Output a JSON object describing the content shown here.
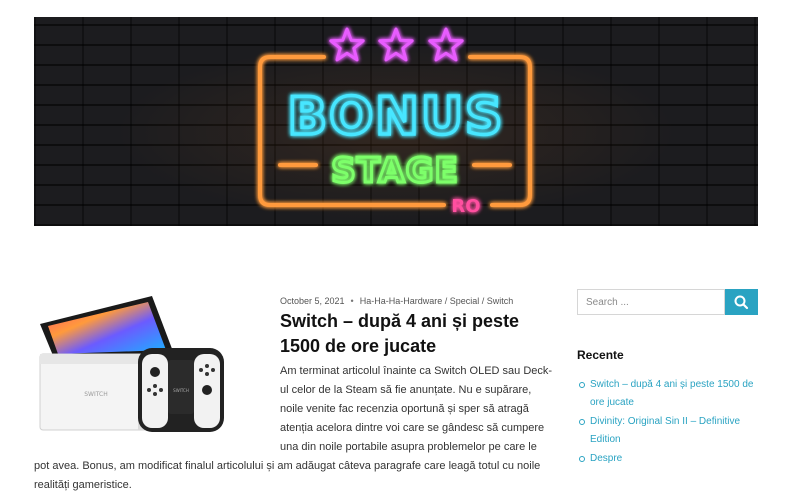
{
  "banner": {
    "word_top": "BONUS",
    "word_bottom": "STAGE",
    "suffix": "RO",
    "colors": {
      "frame": "#ff9a3c",
      "stars": "#e85cff",
      "bonus": "#47e6ff",
      "stage": "#7dff6b",
      "suffix": "#ff4fa0"
    }
  },
  "post": {
    "date": "October 5, 2021",
    "meta_separator": "•",
    "categories": [
      "Ha-Ha-Ha-Hardware",
      "Special",
      "Switch"
    ],
    "category_separator": " / ",
    "title": "Switch – după 4 ani și peste 1500 de ore jucate",
    "excerpt": "Am terminat articolul înainte ca Switch OLED sau Deck-ul celor de la Steam să fie anunțate. Nu e supărare, noile venite fac recenzia oportună și sper să atragă atenția acelora dintre voi care se gândesc să cumpere una din noile portabile asupra problemelor pe care le pot avea. Bonus, am modificat finalul articolului și am adăugat câteva paragrafe care leagă totul cu noile realități gameristice."
  },
  "sidebar": {
    "search": {
      "placeholder": "Search ...",
      "value": "",
      "button_icon": "search-icon"
    },
    "recent": {
      "title": "Recente",
      "items": [
        {
          "label": "Switch – după 4 ani și peste 1500 de ore jucate"
        },
        {
          "label": "Divinity: Original Sin II – Definitive Edition"
        },
        {
          "label": "Despre"
        }
      ]
    }
  },
  "colors": {
    "accent": "#2aa3c2",
    "text": "#333333",
    "heading": "#111111"
  }
}
